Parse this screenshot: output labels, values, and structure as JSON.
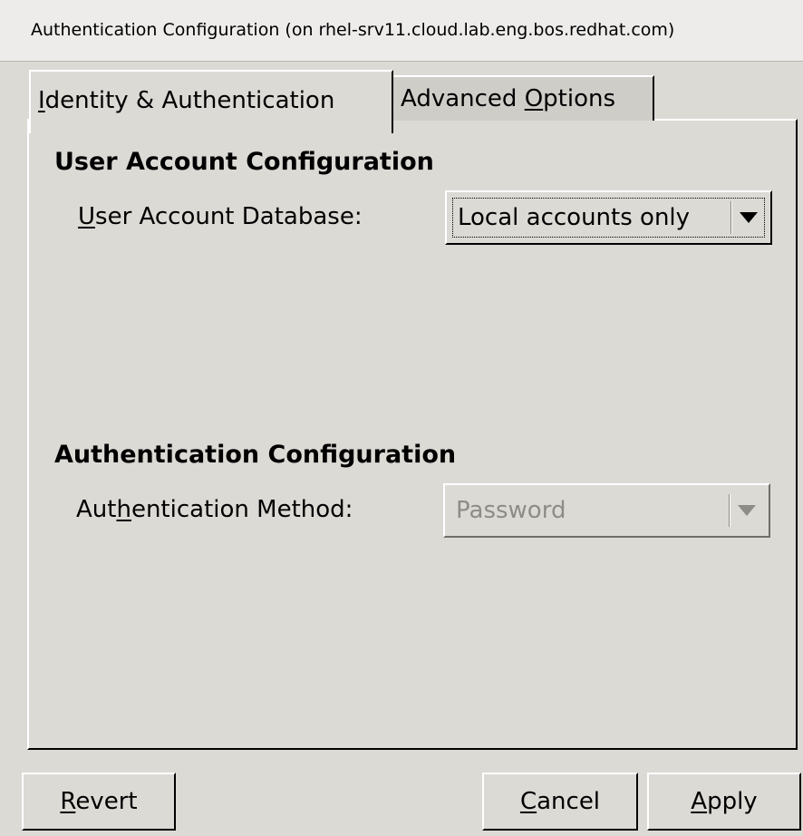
{
  "window": {
    "title": "Authentication Configuration (on rhel-srv11.cloud.lab.eng.bos.redhat.com)"
  },
  "tabs": [
    {
      "prefix": "",
      "mnemonic": "I",
      "suffix": "dentity & Authentication",
      "active": true
    },
    {
      "prefix": "Advanced ",
      "mnemonic": "O",
      "suffix": "ptions",
      "active": false
    }
  ],
  "user_account": {
    "section_title": "User Account Configuration",
    "label_mnemonic": "U",
    "label_rest": "ser Account Database:",
    "value": "Local accounts only",
    "arrow_icon": "dropdown-arrow-icon"
  },
  "authentication": {
    "section_title": "Authentication Configuration",
    "label_pre": "Aut",
    "label_mnemonic": "h",
    "label_post": "entication Method:",
    "value": "Password",
    "disabled": true,
    "arrow_icon": "dropdown-arrow-icon"
  },
  "buttons": {
    "revert": {
      "mnemonic": "R",
      "rest": "evert"
    },
    "cancel": {
      "mnemonic": "C",
      "rest": "ancel"
    },
    "apply": {
      "mnemonic": "A",
      "rest": "pply"
    }
  },
  "colors": {
    "background": "#dcdad5",
    "disabled_text": "#8e8c87"
  }
}
